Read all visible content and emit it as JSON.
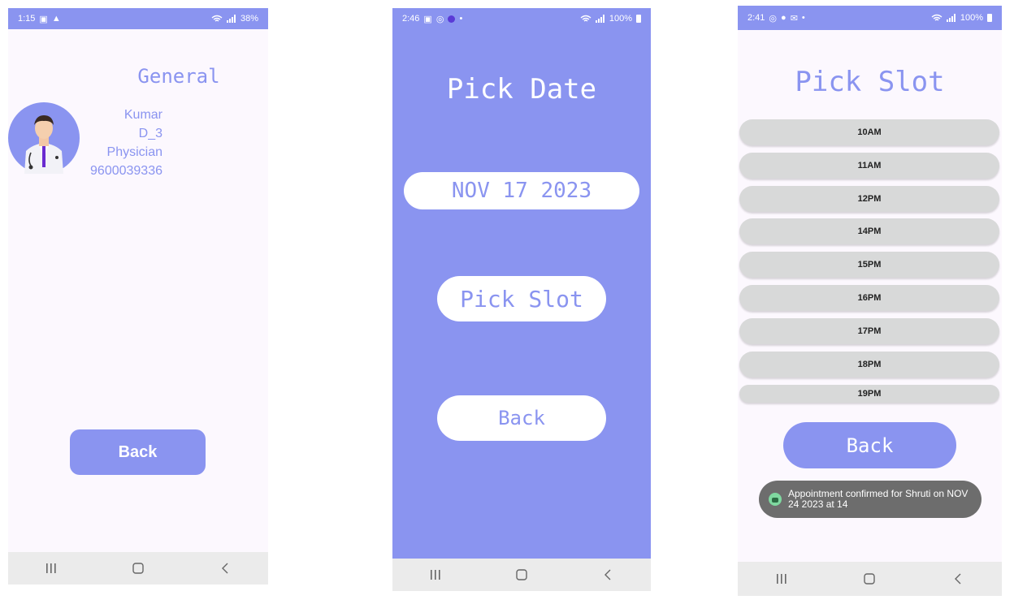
{
  "screen1": {
    "status": {
      "time": "1:15",
      "battery": "38%"
    },
    "title": "General",
    "doctor": {
      "name": "Kumar",
      "id": "D_3",
      "specialty": "Physician",
      "phone": "9600039336"
    },
    "back_label": "Back"
  },
  "screen2": {
    "status": {
      "time": "2:46",
      "battery": "100%"
    },
    "title": "Pick Date",
    "date_value": "NOV 17 2023",
    "pick_slot_label": "Pick Slot",
    "back_label": "Back"
  },
  "screen3": {
    "status": {
      "time": "2:41",
      "battery": "100%"
    },
    "title": "Pick Slot",
    "slots": [
      "10AM",
      "11AM",
      "12PM",
      "14PM",
      "15PM",
      "16PM",
      "17PM",
      "18PM",
      "19PM"
    ],
    "back_label": "Back",
    "toast": "Appointment confirmed for Shruti on NOV 24 2023 at 14"
  },
  "colors": {
    "accent": "#8a94f0",
    "slot_bg": "#d8d9d9",
    "toast_bg": "#6d6d6d"
  },
  "icons": {
    "nav": [
      "recents-icon",
      "home-icon",
      "back-nav-icon"
    ],
    "status": [
      "wifi-icon",
      "signal-icon",
      "battery-icon"
    ]
  }
}
